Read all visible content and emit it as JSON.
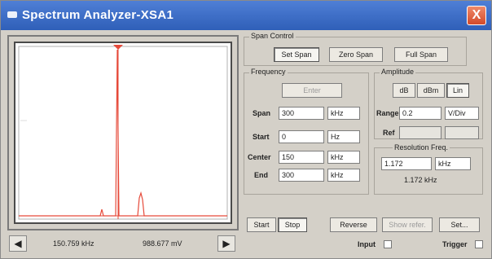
{
  "window": {
    "title": "Spectrum Analyzer-XSA1",
    "close_label": "X"
  },
  "screen": {
    "colors": {
      "trace": "#e64a3a",
      "marker": "#e64a3a",
      "frame": "#4a4a4a"
    }
  },
  "readout": {
    "frequency": "150.759 kHz",
    "amplitude": "988.677 mV"
  },
  "span_control": {
    "title": "Span Control",
    "buttons": [
      "Set Span",
      "Zero Span",
      "Full Span"
    ],
    "selected": "Set Span"
  },
  "frequency": {
    "title": "Frequency",
    "enter_label": "Enter",
    "rows": [
      {
        "label": "Span",
        "value": "300",
        "unit": "kHz"
      },
      {
        "label": "Start",
        "value": "0",
        "unit": "Hz"
      },
      {
        "label": "Center",
        "value": "150",
        "unit": "kHz"
      },
      {
        "label": "End",
        "value": "300",
        "unit": "kHz"
      }
    ]
  },
  "amplitude": {
    "title": "Amplitude",
    "buttons": [
      "dB",
      "dBm",
      "Lin"
    ],
    "selected": "Lin",
    "range_label": "Range",
    "range_value": "0.2",
    "range_unit": "V/Div",
    "ref_label": "Ref",
    "ref_value": "",
    "ref_unit": ""
  },
  "resolution": {
    "title": "Resolution Freq.",
    "value": "1.172",
    "unit": "kHz",
    "display": "1.172 kHz"
  },
  "bottom_buttons": {
    "start": "Start",
    "stop": "Stop",
    "reverse": "Reverse",
    "show_refer": "Show refer.",
    "set": "Set..."
  },
  "io": {
    "input_label": "Input",
    "trigger_label": "Trigger"
  }
}
